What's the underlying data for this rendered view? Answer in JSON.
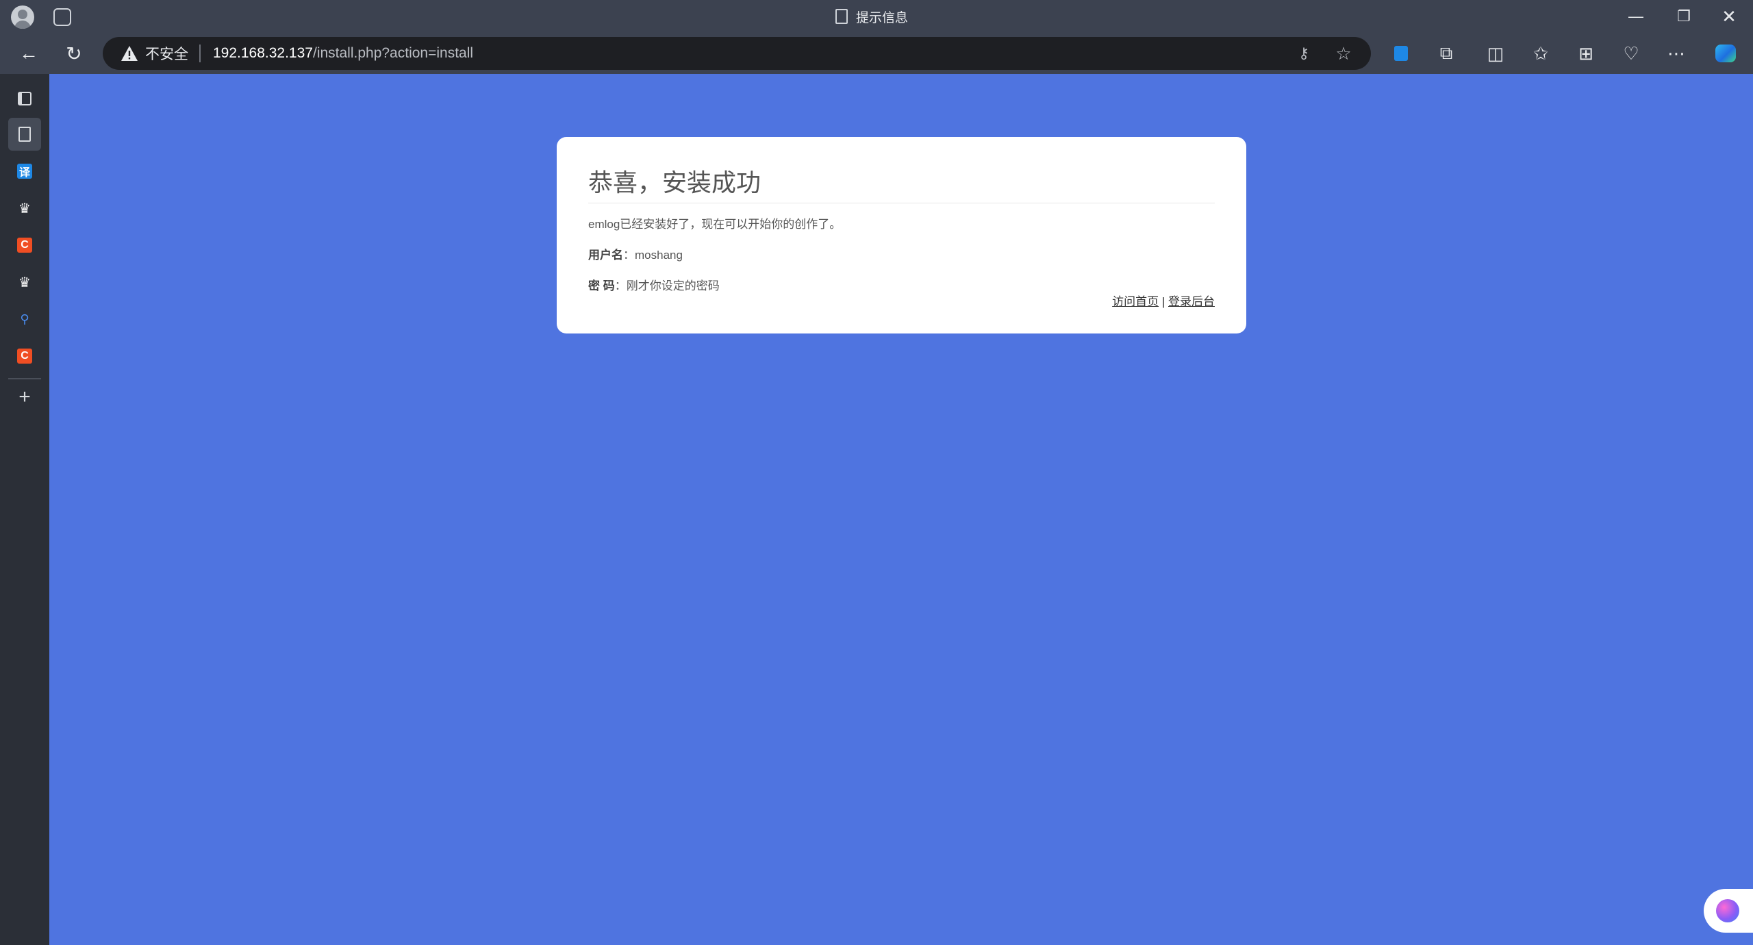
{
  "browser": {
    "window_title": "提示信息",
    "security_label": "不安全",
    "url_host": "192.168.32.137",
    "url_path": "/install.php?action=install",
    "sidebar_items": [
      {
        "icon": "tab-actions-icon"
      },
      {
        "icon": "page-icon",
        "active": true
      },
      {
        "icon": "translate-icon",
        "badge": "译",
        "color": "#1e88e5"
      },
      {
        "icon": "crown-icon"
      },
      {
        "icon": "c-app-icon",
        "badge": "C",
        "color": "#f04e23"
      },
      {
        "icon": "crown-icon"
      },
      {
        "icon": "search-icon"
      },
      {
        "icon": "c-app-icon",
        "badge": "C",
        "color": "#f04e23"
      },
      {
        "icon": "add-icon"
      }
    ]
  },
  "page": {
    "heading": "恭喜，安装成功",
    "intro": "emlog已经安装好了，现在可以开始你的创作了。",
    "username_label": "用户名",
    "username_value": "moshang",
    "password_label": "密 码",
    "password_value": "刚才你设定的密码",
    "colon": "：",
    "link_home": "访问首页",
    "link_separator": " | ",
    "link_admin": "登录后台"
  },
  "colors": {
    "page_background": "#4f74e0",
    "card_background": "#ffffff",
    "chrome_background": "#3c4250"
  }
}
